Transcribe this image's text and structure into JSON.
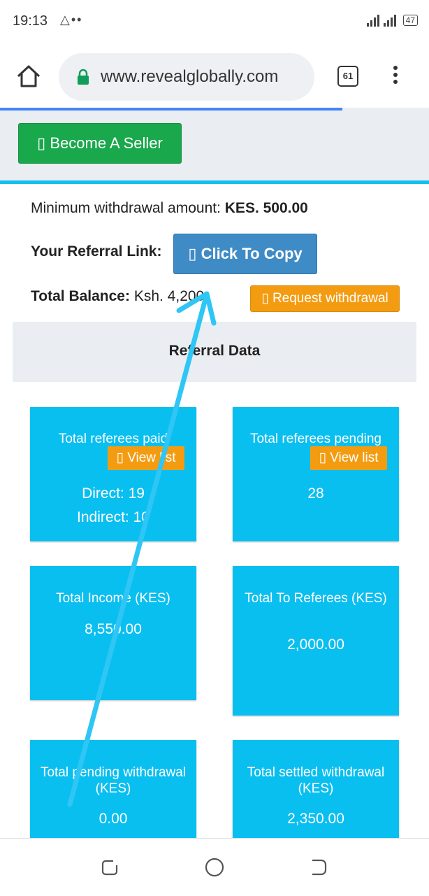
{
  "status_bar": {
    "time": "19:13",
    "left_icons": "△••",
    "battery": "47"
  },
  "browser": {
    "url": "www.revealglobally.com",
    "tab_count": "61"
  },
  "seller": {
    "label": "▯ Become A Seller"
  },
  "withdrawal": {
    "min_label": "Minimum withdrawal amount: ",
    "min_value": "KES. 500.00",
    "request_label": "▯ Request withdrawal"
  },
  "referral_link": {
    "label": "Your Referral Link:",
    "button": "▯ Click To Copy"
  },
  "balance": {
    "label": "Total Balance:",
    "value": "Ksh. 4,200"
  },
  "referral_data": {
    "title": "Referral Data",
    "paid": {
      "title": "Total referees paid",
      "view": "▯ View list",
      "direct": "Direct: 19",
      "indirect": "Indirect: 10"
    },
    "pending": {
      "title": "Total referees pending",
      "view": "▯ View list",
      "value": "28"
    },
    "income": {
      "title": "Total Income (KES)",
      "value": "8,550.00"
    },
    "to_referees": {
      "title": "Total To Referees (KES)",
      "value": "2,000.00"
    },
    "pending_withdrawal": {
      "title": "Total pending withdrawal (KES)",
      "value": "0.00"
    },
    "settled_withdrawal": {
      "title": "Total settled withdrawal (KES)",
      "value": "2,350.00"
    }
  },
  "colors": {
    "accent_cyan": "#09bff0",
    "orange": "#f39c12",
    "green": "#1aa84c",
    "copy_blue": "#3f8bc5",
    "annotation_arrow": "#2fc6f5"
  }
}
